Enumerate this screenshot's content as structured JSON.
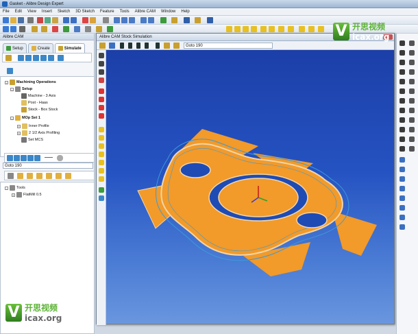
{
  "window": {
    "title": "Gasket - Alibre Design Expert"
  },
  "menu": [
    "File",
    "Edit",
    "View",
    "Insert",
    "Sketch",
    "3D Sketch",
    "Feature",
    "Tools",
    "Alibre CAM",
    "Window",
    "Help"
  ],
  "left_panel": {
    "title": "Alibre CAM",
    "tabs": [
      {
        "label": "Setup"
      },
      {
        "label": "Create"
      },
      {
        "label": "Simulate"
      }
    ],
    "tree": [
      {
        "label": "Machining Operations",
        "bold": true
      },
      {
        "label": "Setup",
        "bold": true
      },
      {
        "label": "Machine - 3 Axis"
      },
      {
        "label": "Post - Haas"
      },
      {
        "label": "Stock - Box Stock"
      },
      {
        "label": "MOp Set 1",
        "bold": true
      },
      {
        "label": "Inner Profile"
      },
      {
        "label": "2 1/2 Axis Profiling"
      },
      {
        "label": "Set MCS"
      }
    ],
    "goto_value": "Goto 190",
    "tools_tree": [
      {
        "label": "Tools"
      },
      {
        "label": "FlatMill 0.5"
      }
    ]
  },
  "sim_window": {
    "title": "Alibre CAM Stock Simulation",
    "goto_value": "Goto 190"
  },
  "watermark": {
    "cn": "开思视频",
    "url": "icax.org"
  },
  "colors": {
    "part_fill": "#f29a2a",
    "part_edge": "#f2d6a8",
    "viewport_top": "#1c3fa8",
    "viewport_bottom": "#6a96de"
  }
}
